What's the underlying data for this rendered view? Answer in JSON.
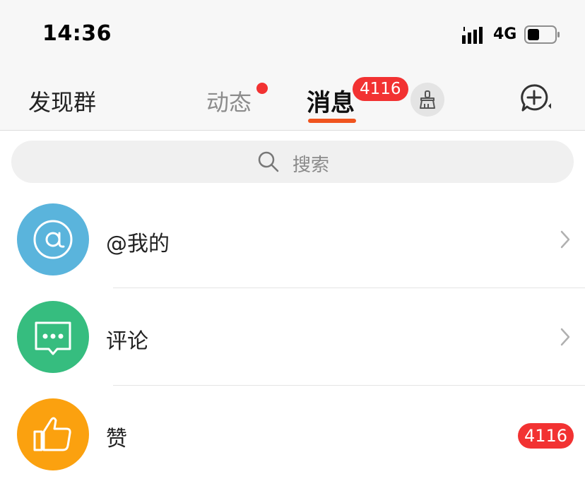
{
  "status_bar": {
    "time": "14:36",
    "network": "4G",
    "icons": [
      "signal-bars-icon",
      "battery-icon"
    ]
  },
  "nav": {
    "left_label": "发现群",
    "tabs": [
      {
        "label": "动态",
        "has_dot": true
      },
      {
        "label": "消息",
        "badge": "4116",
        "active": true
      }
    ],
    "clean_icon": "broom-icon",
    "compose_icon": "add-chat-icon"
  },
  "search": {
    "placeholder": "搜索",
    "icon": "search-icon"
  },
  "list": [
    {
      "label": "@我的",
      "icon": "at-icon",
      "color": "#5ab4dc",
      "chevron": true
    },
    {
      "label": "评论",
      "icon": "comment-icon",
      "color": "#36bd7f",
      "chevron": true
    },
    {
      "label": "赞",
      "icon": "thumbs-up-icon",
      "color": "#fba10f",
      "badge": "4116"
    }
  ],
  "colors": {
    "accent": "#f0541e",
    "badge": "#f23232",
    "nav_bg": "#f7f7f7"
  }
}
